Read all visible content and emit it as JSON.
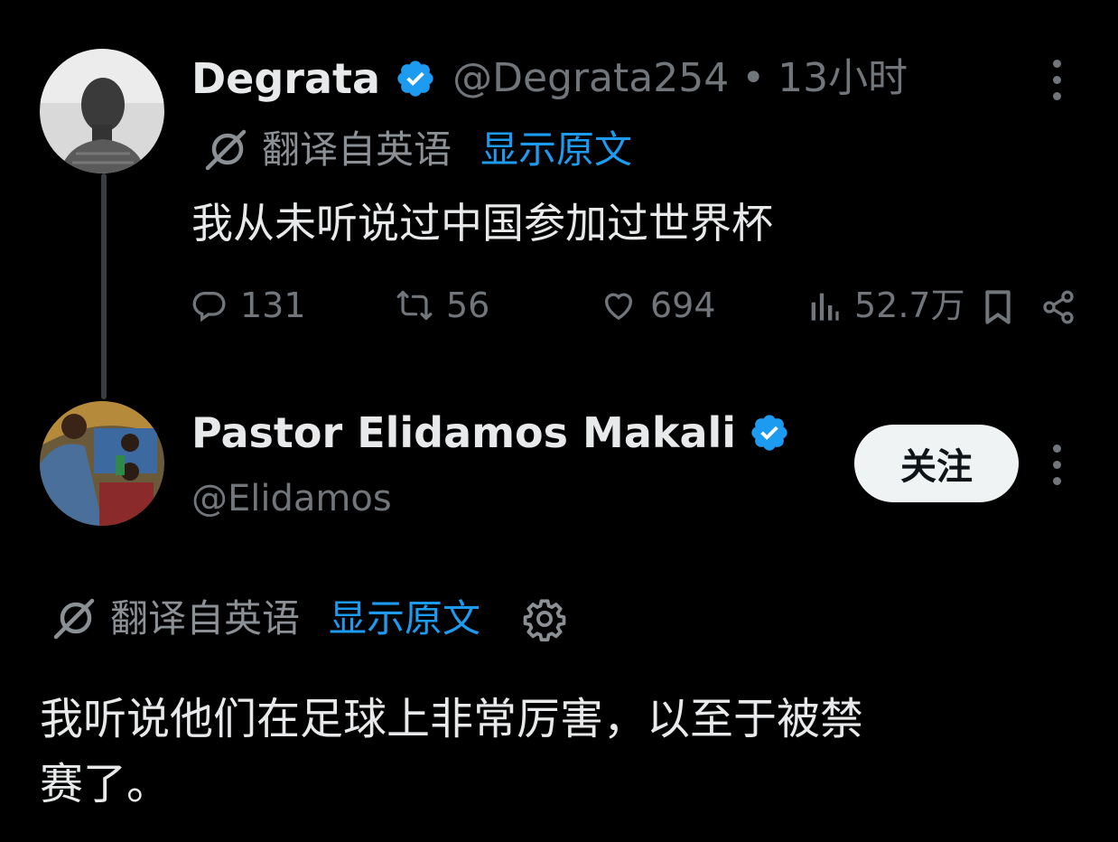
{
  "tweet1": {
    "display_name": "Degrata",
    "handle_time": "@Degrata254 • 13小时",
    "translated_label": "翻译自英语",
    "show_original": "显示原文",
    "text": "我从未听说过中国参加过世界杯",
    "actions": {
      "replies": "131",
      "retweets": "56",
      "likes": "694",
      "views": "52.7万"
    }
  },
  "tweet2": {
    "display_name": "Pastor Elidamos Makali",
    "handle": "@Elidamos",
    "follow_label": "关注",
    "translated_label": "翻译自英语",
    "show_original": "显示原文",
    "text_line1": "我听说他们在足球上非常厉害，以至于被禁",
    "text_line2": "赛了。"
  },
  "colors": {
    "background": "#000000",
    "primary_text": "#e7e9ea",
    "secondary_text": "#71767b",
    "link": "#1d9bf0",
    "verified_badge": "#1d9bf0",
    "follow_button_bg": "#eff3f4"
  },
  "icons": [
    "avatar",
    "verified-badge-icon",
    "translate-icon",
    "reply-icon",
    "retweet-icon",
    "like-icon",
    "views-icon",
    "bookmark-icon",
    "share-icon",
    "more-icon",
    "gear-icon"
  ]
}
